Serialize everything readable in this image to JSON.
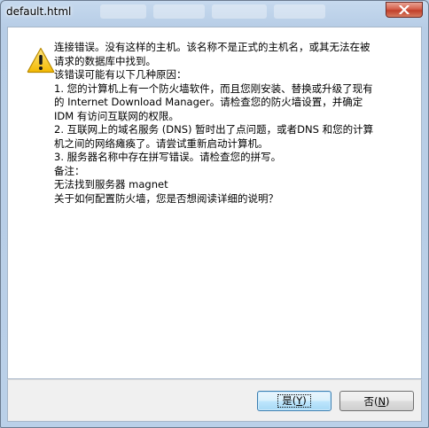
{
  "window": {
    "title": "default.html",
    "close_icon": "close-icon"
  },
  "dialog": {
    "icon": "warning-icon",
    "lines": [
      "连接错误。没有这样的主机。该名称不是正式的主机名，或其无法在被",
      "请求的数据库中找到。",
      "",
      "该错误可能有以下几种原因：",
      "",
      "1. 您的计算机上有一个防火墙软件，而且您刚安装、替换或升级了现有",
      "的 Internet Download Manager。请检查您的防火墙设置，并确定",
      "IDM 有访问互联网的权限。",
      "",
      "2. 互联网上的域名服务 (DNS) 暂时出了点问题，或者DNS 和您的计算",
      "机之间的网络瘫痪了。请尝试重新启动计算机。",
      "",
      "3. 服务器名称中存在拼写错误。请检查您的拼写。",
      "",
      "",
      "",
      "备注：",
      "无法找到服务器 magnet",
      "",
      "",
      "",
      "关于如何配置防火墙，您是否想阅读详细的说明？"
    ]
  },
  "buttons": {
    "yes": {
      "label": "是",
      "accel": "Y",
      "paren_open": "(",
      "paren_close": ")"
    },
    "no": {
      "label": "否",
      "accel": "N",
      "paren_open": "(",
      "paren_close": ")"
    }
  }
}
